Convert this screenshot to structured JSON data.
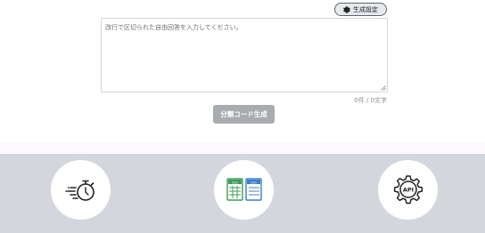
{
  "settings": {
    "label": "生成設定",
    "icon": "gear-icon"
  },
  "input": {
    "placeholder": "改行で区切られた自由回答を入力してください。",
    "value": ""
  },
  "counter": {
    "text": "0件 / 0文字"
  },
  "generate": {
    "label": "分類コード生成"
  },
  "features": [
    {
      "icon": "fast-stopwatch-icon"
    },
    {
      "icon": "spreadsheet-files-icon",
      "labels": [
        "XLS",
        "CSV"
      ]
    },
    {
      "icon": "api-gear-icon",
      "label": "API"
    }
  ],
  "colors": {
    "button_disabled": "#a8abb0",
    "footer_bg": "#d3d6dc",
    "accent_green": "#3f9b58",
    "accent_blue": "#3d7cc9",
    "icon_dark": "#222222"
  }
}
